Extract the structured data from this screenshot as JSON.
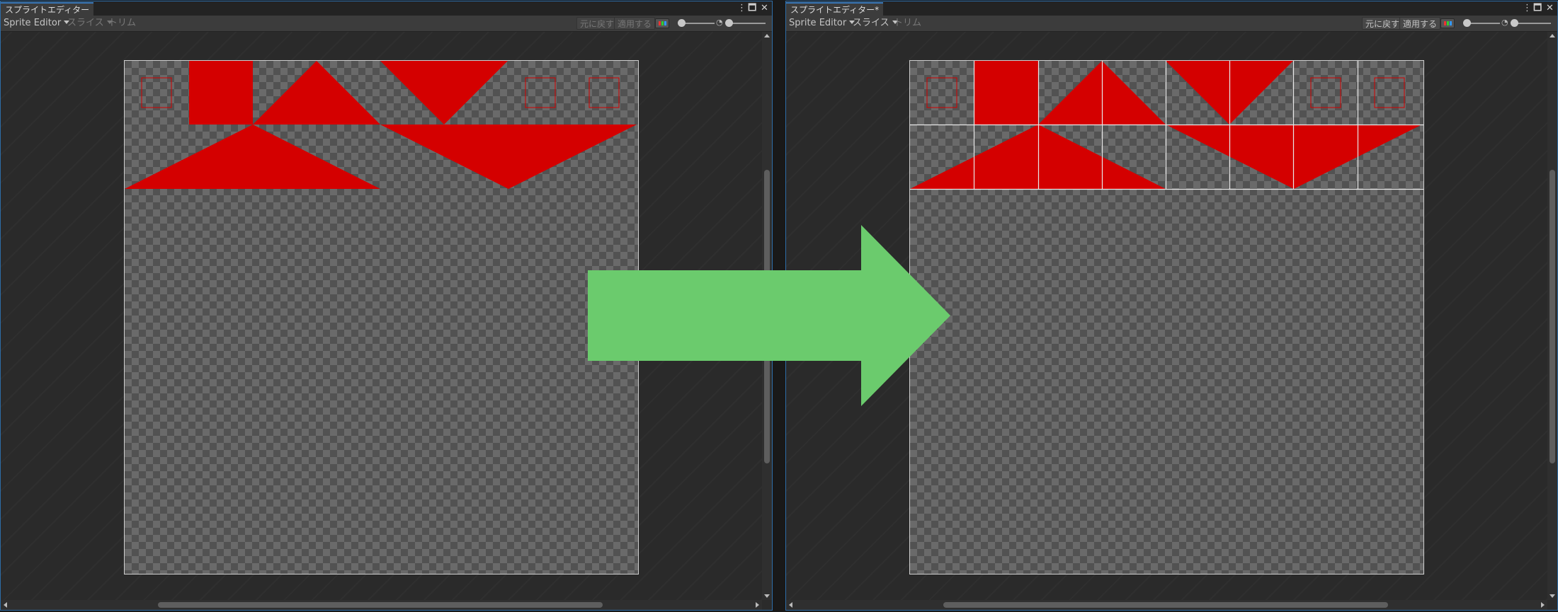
{
  "left_window": {
    "tab_title": "スプライトエディター",
    "mode_dropdown": "Sprite Editor",
    "slice_label": "スライス",
    "trim_label": "トリム",
    "revert_label": "元に戻す",
    "apply_label": "適用する"
  },
  "right_window": {
    "tab_title": "スプライトエディター*",
    "mode_dropdown": "Sprite Editor",
    "slice_label": "スライス",
    "trim_label": "トリム",
    "revert_label": "元に戻す",
    "apply_label": "適用する"
  },
  "colors": {
    "sprite_red": "#d40000",
    "arrow_green": "#6bcb6d",
    "window_border": "#2d6da8",
    "slice_grid": "#e8e8e8"
  },
  "icons": [
    "kebab-menu-icon",
    "maximize-icon",
    "close-icon",
    "chevron-down-icon",
    "rgb-channel-icon",
    "zoom-slider-icon",
    "right-arrow-icon"
  ]
}
